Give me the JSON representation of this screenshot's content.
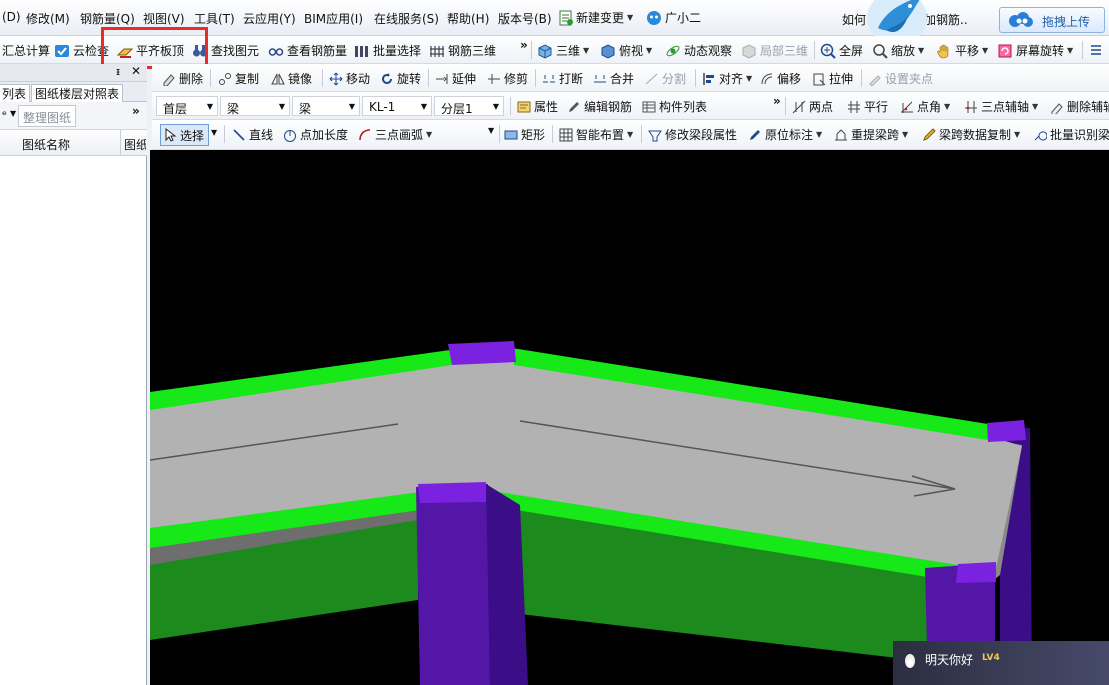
{
  "menubar": {
    "items": [
      "(D)",
      "修改(M)",
      "钢筋量(Q)",
      "视图(V)",
      "工具(T)",
      "云应用(Y)",
      "BIM应用(I)",
      "在线服务(S)",
      "帮助(H)",
      "版本号(B)"
    ],
    "new_change": "新建变更",
    "assistant": "广小二"
  },
  "promo": {
    "text1": "如何",
    "text2": "加钢筋..",
    "upload": "拖拽上传"
  },
  "toolbar1": {
    "summary_calc": "汇总计算",
    "cloud_check": "云检查",
    "flush_slab_top": "平齐板顶",
    "find_element": "查找图元",
    "view_rebar": "查看钢筋量",
    "batch_select": "批量选择",
    "rebar_3d": "钢筋三维",
    "view_3d": "三维",
    "top_view": "俯视",
    "dynamic_observe": "动态观察",
    "local_3d": "局部三维",
    "fullscreen": "全屏",
    "zoom": "缩放",
    "pan": "平移",
    "screen_rotate": "屏幕旋转"
  },
  "toolbar2": {
    "delete": "删除",
    "copy": "复制",
    "mirror": "镜像",
    "move": "移动",
    "rotate": "旋转",
    "extend": "延伸",
    "trim": "修剪",
    "break": "打断",
    "merge": "合并",
    "split": "分割",
    "align": "对齐",
    "offset": "偏移",
    "stretch": "拉伸",
    "set_grip": "设置夹点"
  },
  "toolbar3": {
    "floor": "首层",
    "category": "梁",
    "type": "梁",
    "element": "KL-1",
    "layer": "分层1",
    "properties": "属性",
    "edit_rebar": "编辑钢筋",
    "component_list": "构件列表",
    "two_points": "两点",
    "parallel": "平行",
    "point_angle": "点角",
    "three_point_axis": "三点辅轴",
    "delete_axis": "删除辅轴"
  },
  "toolbar4": {
    "select": "选择",
    "line": "直线",
    "point_length": "点加长度",
    "three_point_arc": "三点画弧",
    "rectangle": "矩形",
    "smart_layout": "智能布置",
    "modify_beam_props": "修改梁段属性",
    "in_situ_label": "原位标注",
    "re_extract_span": "重提梁跨",
    "copy_span_data": "梁跨数据复制",
    "batch_identify": "批量识别梁"
  },
  "panel": {
    "tab_list": "列表",
    "tab_floor_map": "图纸楼层对照表",
    "organize": "整理图纸",
    "col_name": "图纸名称",
    "col_other": "图纸"
  },
  "chat": {
    "name": "明天你好",
    "level": "LV4"
  },
  "colors": {
    "highlight": "#e82c2c",
    "beam_top": "#b2b2b2",
    "beam_edge": "#17e817",
    "beam_side": "#1c8a1c",
    "column": "#5316a6",
    "column_top": "#7a22e0",
    "viewport_bg": "#000000"
  }
}
